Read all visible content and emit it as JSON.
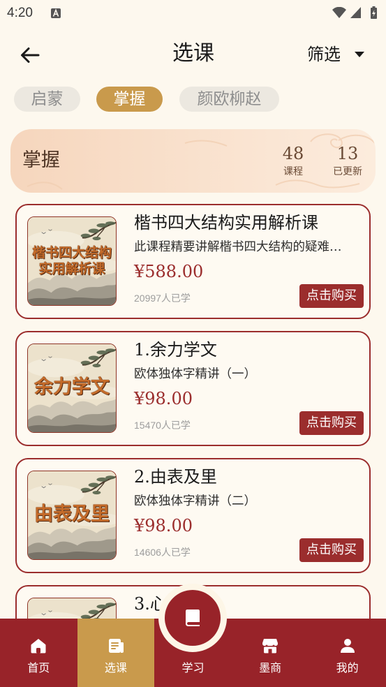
{
  "status_bar": {
    "time": "4:20",
    "icons": [
      "a-notification-icon",
      "wifi-icon",
      "signal-icon",
      "battery-charging-icon"
    ]
  },
  "header": {
    "back_icon": "arrow-left-icon",
    "title": "选课",
    "filter_label": "筛选",
    "filter_icon": "caret-down-icon"
  },
  "tabs": [
    {
      "label": "启蒙",
      "selected": false
    },
    {
      "label": "掌握",
      "selected": true
    },
    {
      "label": "颜欧柳赵",
      "selected": false
    }
  ],
  "summary": {
    "title": "掌握",
    "stats": [
      {
        "value": "48",
        "label": "课程"
      },
      {
        "value": "13",
        "label": "已更新"
      }
    ]
  },
  "courses": [
    {
      "thumb_lines": [
        "楷书四大结构",
        "实用解析课"
      ],
      "title": "楷书四大结构实用解析课",
      "description": "此课程精要讲解楷书四大结构的疑难…",
      "price": "¥588.00",
      "learners": "20997人已学",
      "buy_label": "点击购买"
    },
    {
      "thumb_lines": [
        "余力学文"
      ],
      "title": "1.余力学文",
      "description": "欧体独体字精讲（一）",
      "price": "¥98.00",
      "learners": "15470人已学",
      "buy_label": "点击购买"
    },
    {
      "thumb_lines": [
        "由表及里"
      ],
      "title": "2.由表及里",
      "description": "欧体独体字精讲（二）",
      "price": "¥98.00",
      "learners": "14606人已学",
      "buy_label": "点击购买"
    },
    {
      "thumb_lines": [],
      "title": "3.心"
    }
  ],
  "bottom_nav": {
    "center_icon": "book-icon",
    "items": [
      {
        "label": "首页",
        "icon": "home-icon",
        "selected": false
      },
      {
        "label": "选课",
        "icon": "course-list-icon",
        "selected": true
      },
      {
        "label": "学习",
        "icon": "book-icon",
        "selected": false
      },
      {
        "label": "墨商",
        "icon": "store-icon",
        "selected": false
      },
      {
        "label": "我的",
        "icon": "person-icon",
        "selected": false
      }
    ]
  },
  "colors": {
    "page_background": "#fdf8ee",
    "primary_red": "#9b2d2d",
    "accent_gold": "#c99a4c",
    "nav_background": "#982329",
    "pill_background": "#ece8e0",
    "pill_text": "#8e8e8e",
    "summary_gradient": [
      "#f6d6bd",
      "#fcecdd"
    ]
  }
}
